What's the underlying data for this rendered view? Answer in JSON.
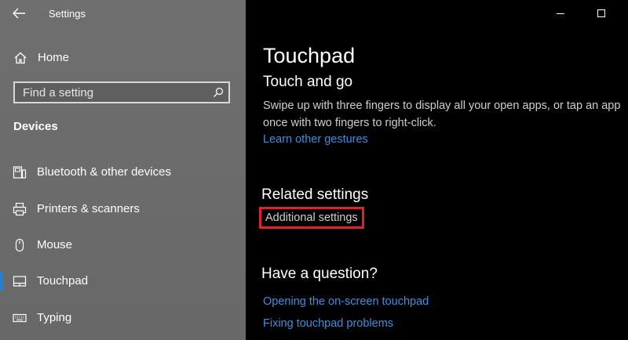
{
  "window": {
    "app_title": "Settings"
  },
  "sidebar": {
    "home_label": "Home",
    "search_placeholder": "Find a setting",
    "section_title": "Devices",
    "items": [
      {
        "label": "Bluetooth & other devices",
        "icon": "bluetooth-device-icon"
      },
      {
        "label": "Printers & scanners",
        "icon": "printer-icon"
      },
      {
        "label": "Mouse",
        "icon": "mouse-icon"
      },
      {
        "label": "Touchpad",
        "icon": "touchpad-icon",
        "selected": true
      },
      {
        "label": "Typing",
        "icon": "keyboard-icon"
      }
    ]
  },
  "main": {
    "title": "Touchpad",
    "touch_section": {
      "title": "Touch and go",
      "description": "Swipe up with three fingers to display all your open apps, or tap an app once with two fingers to right-click.",
      "link": "Learn other gestures"
    },
    "related_section": {
      "title": "Related settings",
      "link": "Additional settings"
    },
    "question_section": {
      "title": "Have a question?",
      "links": [
        "Opening the on-screen touchpad",
        "Fixing touchpad problems"
      ]
    }
  },
  "colors": {
    "accent": "#1e7fd6",
    "link": "#3d8fe0",
    "highlight_box": "#e1222c",
    "sidebar_bg": "#6b6b6b",
    "main_bg": "#000000"
  }
}
